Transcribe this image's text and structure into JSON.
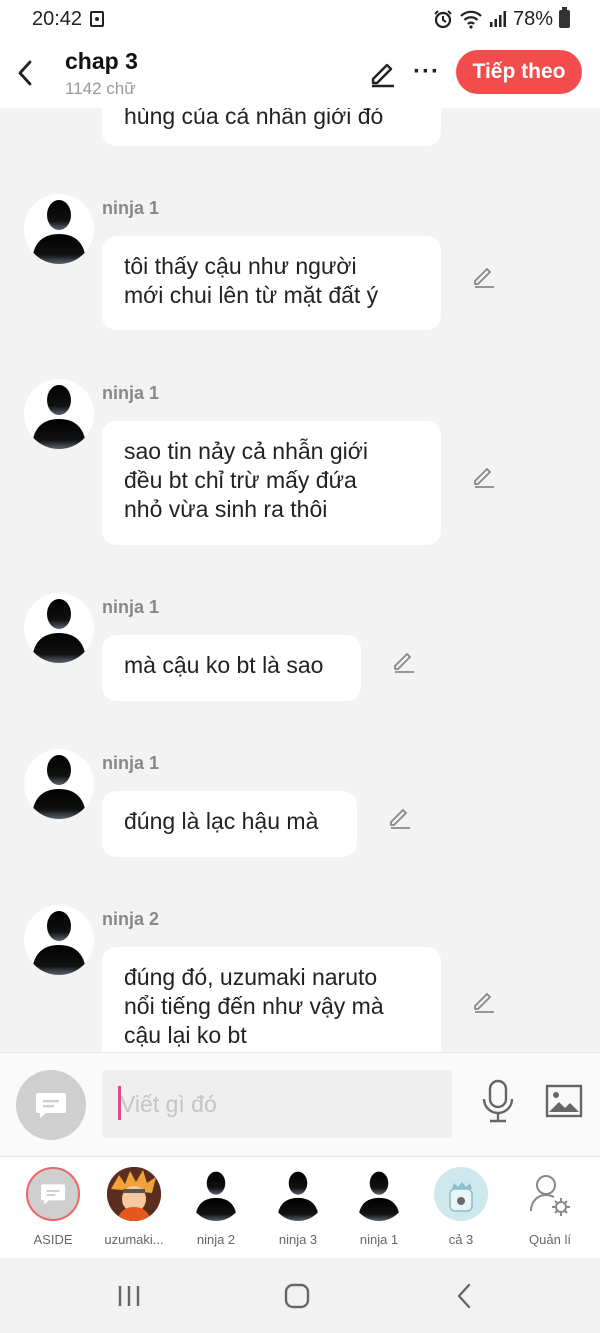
{
  "status_bar": {
    "time": "20:42",
    "battery": "78%"
  },
  "header": {
    "back_icon": "chevron-left-icon",
    "title": "chap 3",
    "word_count": "1142 chữ",
    "next_label": "Tiếp theo",
    "accent_color": "#f24c4c"
  },
  "chat": {
    "partial_message": "hùng của cả nhẫn giới đó",
    "messages": [
      {
        "sender": "ninja 1",
        "text_lines": [
          "tôi thấy cậu như người",
          "mới chui lên từ mặt đất ý"
        ]
      },
      {
        "sender": "ninja 1",
        "text_lines": [
          "sao tin nảy cả nhẫn giới",
          "đều bt chỉ trừ mấy đứa",
          "nhỏ vừa sinh ra thôi"
        ]
      },
      {
        "sender": "ninja 1",
        "text_lines": [
          "mà cậu ko bt là sao"
        ]
      },
      {
        "sender": "ninja 1",
        "text_lines": [
          "đúng là lạc hậu mà"
        ]
      },
      {
        "sender": "ninja 2",
        "text_lines": [
          "đúng đó, uzumaki naruto",
          "nổi tiếng  đến như vậy mà",
          "cậu lại ko bt"
        ]
      }
    ]
  },
  "composer": {
    "placeholder": "Viết gì đó"
  },
  "characters": [
    {
      "label": "ASIDE"
    },
    {
      "label": "uzumaki..."
    },
    {
      "label": "ninja 2"
    },
    {
      "label": "ninja 3"
    },
    {
      "label": "ninja 1"
    },
    {
      "label": "cả 3"
    },
    {
      "label": "Quản lí"
    }
  ]
}
